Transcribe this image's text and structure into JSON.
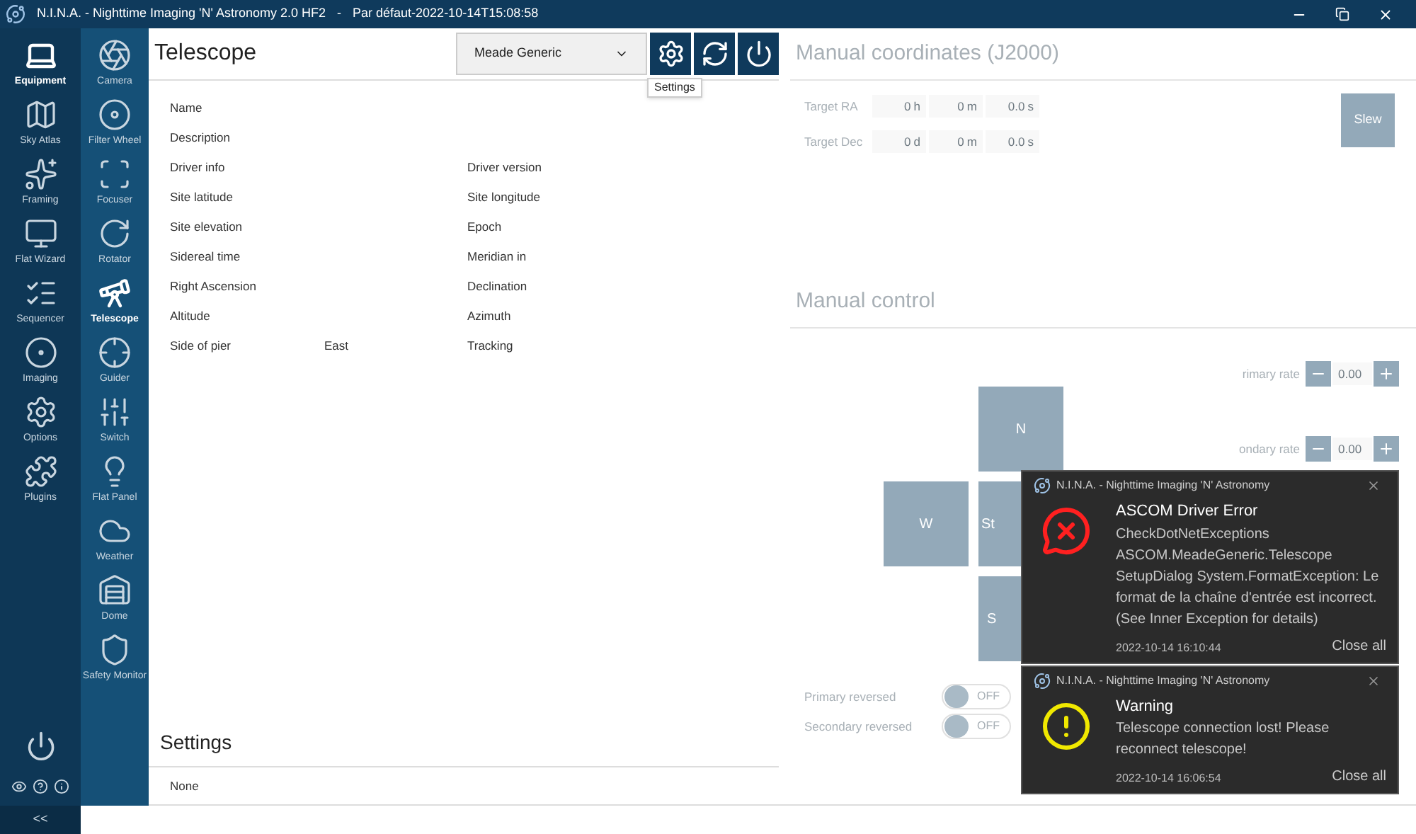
{
  "window": {
    "title": "N.I.N.A. - Nighttime Imaging 'N' Astronomy 2.0 HF2",
    "separator": "-",
    "profile": "Par défaut-2022-10-14T15:08:58"
  },
  "nav_primary": [
    {
      "label": "Equipment",
      "selected": true,
      "kind": "equipment"
    },
    {
      "label": "Sky Atlas",
      "selected": false,
      "kind": "atlas"
    },
    {
      "label": "Framing",
      "selected": false,
      "kind": "framing"
    },
    {
      "label": "Flat Wizard",
      "selected": false,
      "kind": "flat"
    },
    {
      "label": "Sequencer",
      "selected": false,
      "kind": "sequencer"
    },
    {
      "label": "Imaging",
      "selected": false,
      "kind": "imaging"
    },
    {
      "label": "Options",
      "selected": false,
      "kind": "options"
    },
    {
      "label": "Plugins",
      "selected": false,
      "kind": "plugins"
    }
  ],
  "nav_equipment": [
    {
      "label": "Camera",
      "selected": false,
      "kind": "camera"
    },
    {
      "label": "Filter Wheel",
      "selected": false,
      "kind": "filterwheel"
    },
    {
      "label": "Focuser",
      "selected": false,
      "kind": "focuser"
    },
    {
      "label": "Rotator",
      "selected": false,
      "kind": "rotator"
    },
    {
      "label": "Telescope",
      "selected": true,
      "kind": "telescope"
    },
    {
      "label": "Guider",
      "selected": false,
      "kind": "guider"
    },
    {
      "label": "Switch",
      "selected": false,
      "kind": "switch"
    },
    {
      "label": "Flat Panel",
      "selected": false,
      "kind": "flatpanel"
    },
    {
      "label": "Weather",
      "selected": false,
      "kind": "weather"
    },
    {
      "label": "Dome",
      "selected": false,
      "kind": "dome"
    },
    {
      "label": "Safety Monitor",
      "selected": false,
      "kind": "safety"
    }
  ],
  "collapse": "<<",
  "telescope": {
    "title": "Telescope",
    "device": "Meade Generic",
    "tooltip": "Settings",
    "rows": [
      {
        "label": "Name"
      },
      {
        "label": "Description"
      },
      {
        "label": "Driver info",
        "label_2": "Driver version"
      },
      {
        "label": "Site latitude",
        "label_2": "Site longitude"
      },
      {
        "label": "Site elevation",
        "label_2": "Epoch"
      },
      {
        "label": "Sidereal time",
        "label_2": "Meridian in"
      },
      {
        "label": "Right Ascension",
        "label_2": "Declination"
      },
      {
        "label": "Altitude",
        "label_2": "Azimuth"
      },
      {
        "label": "Side of pier",
        "value": "East",
        "label_2": "Tracking"
      }
    ],
    "settings_title": "Settings",
    "settings_value": "None"
  },
  "manual_coordinates": {
    "title": "Manual coordinates (J2000)",
    "rows": [
      {
        "label": "Target RA",
        "fields": [
          {
            "value": "0",
            "unit": "h"
          },
          {
            "value": "0",
            "unit": "m"
          },
          {
            "value": "0.0",
            "unit": "s"
          }
        ]
      },
      {
        "label": "Target Dec",
        "fields": [
          {
            "value": "0",
            "unit": "d"
          },
          {
            "value": "0",
            "unit": "m"
          },
          {
            "value": "0.0",
            "unit": "s"
          }
        ]
      }
    ],
    "slew": "Slew"
  },
  "manual_control": {
    "title": "Manual control",
    "rates": [
      {
        "label": "rimary rate",
        "value": "0.00"
      },
      {
        "label": "ondary rate",
        "value": "0.00"
      }
    ],
    "pad": {
      "north": "N",
      "west": "W",
      "center": "St",
      "south": "S"
    },
    "reversed": [
      {
        "label": "Primary reversed",
        "on": false,
        "text": "OFF"
      },
      {
        "label": "Secondary reversed",
        "on": false,
        "text": "OFF"
      }
    ]
  },
  "notifications": [
    {
      "app": "N.I.N.A. - Nighttime Imaging 'N' Astronomy",
      "kind": "error",
      "title": "ASCOM Driver Error",
      "message": "CheckDotNetExceptions ASCOM.MeadeGeneric.Telescope SetupDialog System.FormatException: Le format de la chaîne d'entrée est incorrect. (See Inner Exception for details)",
      "time": "2022-10-14 16:10:44",
      "action": "Close all"
    },
    {
      "app": "N.I.N.A. - Nighttime Imaging 'N' Astronomy",
      "kind": "warning",
      "title": "Warning",
      "message": "Telescope connection lost! Please reconnect telescope!",
      "time": "2022-10-14 16:06:54",
      "action": "Close all"
    }
  ]
}
